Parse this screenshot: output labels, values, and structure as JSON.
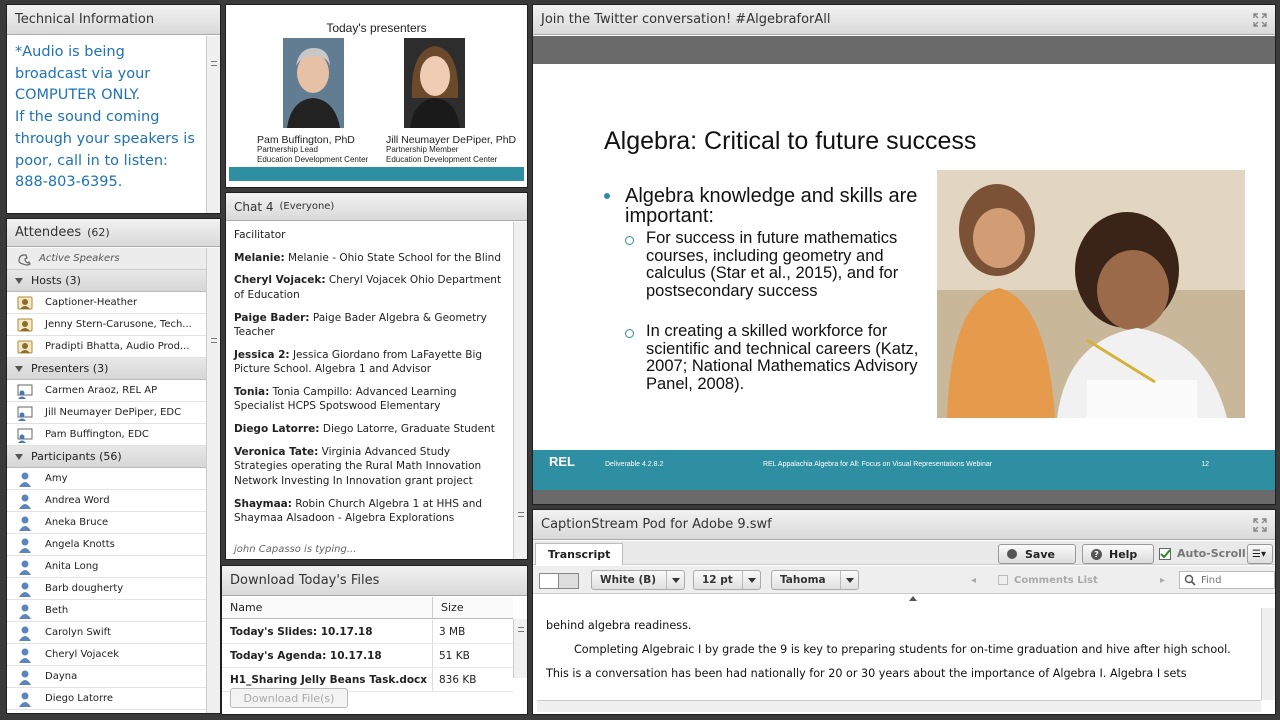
{
  "tech": {
    "title": "Technical Information",
    "lines": [
      "*Audio is being",
      "broadcast via your",
      "COMPUTER ONLY.",
      "If the sound coming",
      "through your speakers is",
      "poor, call in to listen:",
      "888-803-6395."
    ]
  },
  "attendees": {
    "title": "Attendees",
    "count": "(62)",
    "active_speakers": "Active Speakers",
    "hosts_label": "Hosts (3)",
    "hosts": [
      "Captioner-Heather",
      "Jenny Stern-Carusone, Tech...",
      "Pradipti Bhatta, Audio Prod..."
    ],
    "presenters_label": "Presenters (3)",
    "presenters": [
      "Carmen Araoz, REL AP",
      "Jill Neumayer DePiper, EDC",
      "Pam Buffington, EDC"
    ],
    "participants_label": "Participants (56)",
    "participants": [
      "Amy",
      "Andrea Word",
      "Aneka Bruce",
      "Angela Knotts",
      "Anita Long",
      "Barb dougherty",
      "Beth",
      "Carolyn Swift",
      "Cheryl Vojacek",
      "Dayna",
      "Diego Latorre"
    ]
  },
  "presenters_slide": {
    "title": "Today's presenters",
    "p1_name": "Pam Buffington, PhD",
    "p1_role": "Partnership Lead",
    "p1_org": "Education Development Center",
    "p2_name": "Jill Neumayer DePiper, PhD",
    "p2_role": "Partnership Member",
    "p2_org": "Education Development Center"
  },
  "chat": {
    "title": "Chat 4",
    "scope": "(Everyone)",
    "messages": [
      {
        "sender": "",
        "text": "Facilitator"
      },
      {
        "sender": "Melanie:",
        "text": " Melanie - Ohio State School for the Blind"
      },
      {
        "sender": "Cheryl Vojacek:",
        "text": " Cheryl Vojacek Ohio Department of Education"
      },
      {
        "sender": "Paige Bader:",
        "text": " Paige Bader Algebra & Geometry Teacher"
      },
      {
        "sender": "Jessica 2:",
        "text": " Jessica Giordano from LaFayette Big Picture School. Algebra 1 and Advisor"
      },
      {
        "sender": "Tonia:",
        "text": " Tonia Campillo: Advanced Learning Specialist HCPS Spotswood Elementary"
      },
      {
        "sender": "Diego Latorre:",
        "text": " Diego Latorre, Graduate Student"
      },
      {
        "sender": "Veronica Tate:",
        "text": " Virginia Advanced Study Strategies operating the Rural Math Innovation Network Investing In Innovation grant project"
      },
      {
        "sender": "Shaymaa:",
        "text": " Robin Church Algebra 1 at HHS and Shaymaa Alsadoon - Algebra Explorations"
      }
    ],
    "typing": "john Capasso is typing..."
  },
  "downloads": {
    "title": "Download Today's Files",
    "col_name": "Name",
    "col_size": "Size",
    "files": [
      {
        "name": "Today's Slides: 10.17.18",
        "size": "3 MB"
      },
      {
        "name": "Today's Agenda: 10.17.18",
        "size": "51 KB"
      },
      {
        "name": "H1_Sharing Jelly Beans Task.docx",
        "size": "836 KB"
      }
    ],
    "button": "Download File(s)"
  },
  "main": {
    "title": "Join the Twitter conversation!  #AlgebraforAll",
    "slide_title": "Algebra: Critical to future success",
    "bullet1": "Algebra knowledge and skills are important:",
    "sub1": "For success in future mathematics courses, including geometry and calculus (Star et al., 2015), and for postsecondary success",
    "sub2": "In creating a skilled workforce for scientific and technical careers (Katz, 2007; National Mathematics Advisory Panel, 2008).",
    "footer_left": "Deliverable 4.2.8.2",
    "footer_mid": "REL Appalachia Algebra for All: Focus on Visual Representations Webinar",
    "footer_page": "12",
    "logo": "REL"
  },
  "caption": {
    "title": "CaptionStream Pod for Adobe 9.swf",
    "tab": "Transcript",
    "save": "Save",
    "help": "Help",
    "autoscroll": "Auto-Scroll",
    "color": "White (B)",
    "size": "12 pt",
    "font": "Tahoma",
    "comments": "Comments List",
    "find_placeholder": "Find",
    "line1": "behind algebra readiness.",
    "para": "Completing Algebraic I by grade the 9 is key to preparing students for on-time graduation and hive after high school.  This is a conversation has been had nationally for 20 or 30 years about the importance of Algebra I.  Algebra I sets"
  },
  "colors": {
    "accent": "#2e8fa2",
    "tech_text": "#1e72b5"
  }
}
